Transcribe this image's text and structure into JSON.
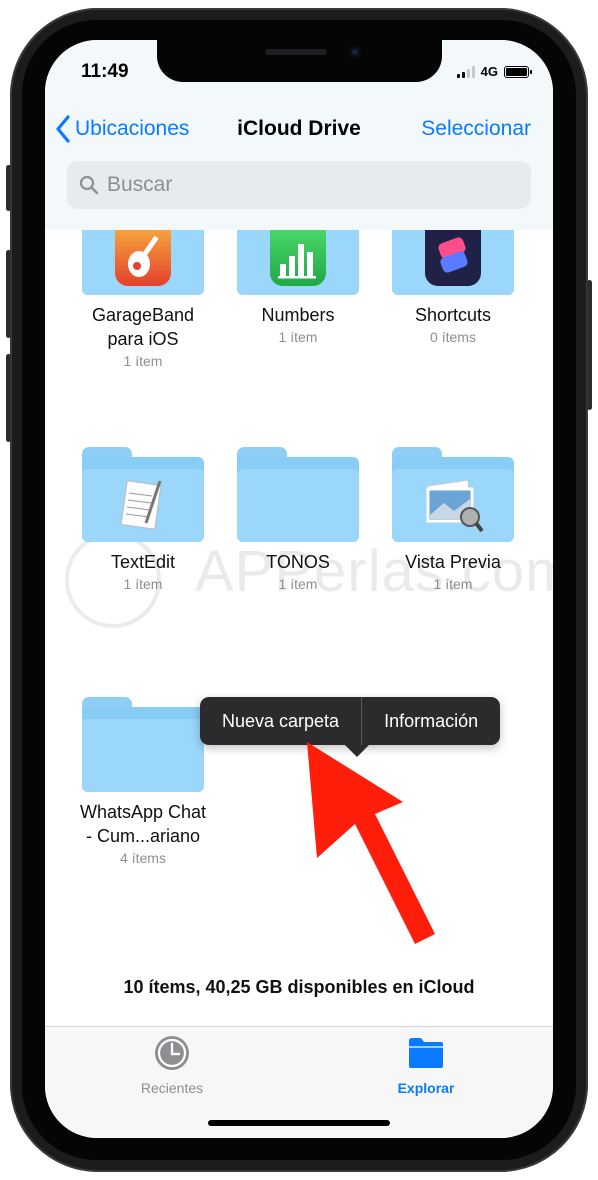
{
  "status_bar": {
    "time": "11:49",
    "network": "4G"
  },
  "nav": {
    "back_label": "Ubicaciones",
    "title": "iCloud Drive",
    "select_label": "Seleccionar"
  },
  "search": {
    "placeholder": "Buscar"
  },
  "items": [
    {
      "name_line1": "GarageBand",
      "name_line2": "para iOS",
      "count": "1 ítem",
      "icon": "garageband-icon"
    },
    {
      "name_line1": "Numbers",
      "name_line2": "",
      "count": "1 ítem",
      "icon": "numbers-icon"
    },
    {
      "name_line1": "Shortcuts",
      "name_line2": "",
      "count": "0 ítems",
      "icon": "shortcuts-icon"
    },
    {
      "name_line1": "TextEdit",
      "name_line2": "",
      "count": "1 ítem",
      "icon": "textedit-icon"
    },
    {
      "name_line1": "TONOS",
      "name_line2": "",
      "count": "1 ítem",
      "icon": "folder-icon"
    },
    {
      "name_line1": "Vista Previa",
      "name_line2": "",
      "count": "1 ítem",
      "icon": "preview-icon"
    },
    {
      "name_line1": "WhatsApp Chat",
      "name_line2": "- Cum...ariano",
      "count": "4 ítems",
      "icon": "folder-icon"
    }
  ],
  "context_menu": {
    "option1": "Nueva carpeta",
    "option2": "Información"
  },
  "watermark": "APPerlas.com",
  "footer": {
    "info": "10 ítems, 40,25 GB disponibles en iCloud"
  },
  "tabbar": {
    "recent_label": "Recientes",
    "browse_label": "Explorar"
  },
  "colors": {
    "accent": "#0a7aff",
    "folder": "#9ad7fa",
    "annotation_arrow": "#ff1e0a",
    "menu_bg": "#2b2b2d"
  }
}
